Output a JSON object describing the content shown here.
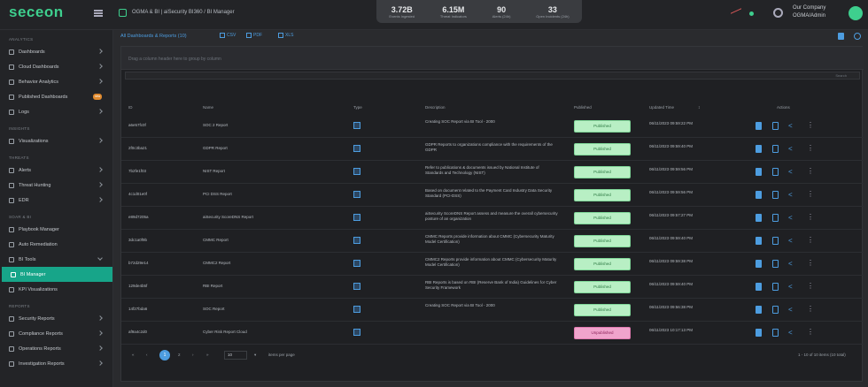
{
  "header": {
    "logo": "seceon",
    "logo_sub": "",
    "breadcrumb": "OGMA & BI | aiSecurity BI360 / BI Manager",
    "stats": [
      {
        "value": "3.72B",
        "label": "Events Ingested"
      },
      {
        "value": "6.15M",
        "label": "Threat Indicators"
      },
      {
        "value": "90",
        "label": "Alerts (24h)"
      },
      {
        "value": "33",
        "label": "Open Incidents (24h)"
      }
    ],
    "company": "Our Company",
    "user": "OGMA/Admin"
  },
  "sidebar": {
    "sections": [
      {
        "title": "ANALYTICS",
        "items": [
          {
            "label": "Dashboards",
            "chev": true
          },
          {
            "label": "Cloud Dashboards",
            "chev": true
          },
          {
            "label": "Behavior Analytics",
            "chev": true
          },
          {
            "label": "Published Dashboards",
            "badge": "new"
          },
          {
            "label": "Logs",
            "chev": true
          }
        ]
      },
      {
        "title": "INSIGHTS",
        "items": [
          {
            "label": "Visualizations",
            "chev": true
          }
        ]
      },
      {
        "title": "THREATS",
        "items": [
          {
            "label": "Alerts",
            "chev": true
          },
          {
            "label": "Threat Hunting",
            "chev": true
          },
          {
            "label": "EDR",
            "chev": true
          }
        ]
      },
      {
        "title": "SOAR & BI",
        "items": [
          {
            "label": "Playbook Manager"
          },
          {
            "label": "Auto Remediation"
          },
          {
            "label": "BI Tools",
            "chev": true,
            "open": true
          },
          {
            "label": "BI Manager",
            "active": true
          },
          {
            "label": "KPI Visualizations"
          }
        ]
      },
      {
        "title": "REPORTS",
        "items": [
          {
            "label": "Security Reports",
            "chev": true
          },
          {
            "label": "Compliance Reports",
            "chev": true
          },
          {
            "label": "Operations Reports",
            "chev": true
          },
          {
            "label": "Investigation Reports",
            "chev": true
          }
        ]
      }
    ]
  },
  "toolbar": {
    "title": "All Dashboards & Reports (10)",
    "buttons": [
      "CSV",
      "PDF",
      "XLS"
    ]
  },
  "grid": {
    "group_hint": "Drag a column header here to group by column",
    "search_placeholder": "Search",
    "columns": {
      "id": "ID",
      "name": "Name",
      "type": "Type",
      "description": "Description",
      "published": "Published",
      "updated": "Updated Time",
      "actions": "Actions"
    },
    "rows": [
      {
        "id": "a6e57fc0f",
        "name": "SOC 2 Report",
        "desc": "Creating SOC Report via BI Tool - 2000",
        "status": "Published",
        "published": true,
        "updated": "06/11/2023 09:59:22 PM"
      },
      {
        "id": "2f0c3ba21",
        "name": "GDPR Report",
        "desc": "GDPR Reports to organizations compliance with the requirements of the GDPR",
        "status": "Published",
        "published": true,
        "updated": "06/11/2023 09:59:40 PM"
      },
      {
        "id": "7b2fe1f03",
        "name": "NIST Report",
        "desc": "Refer to publications & documents issued by National Institute of Standards and Technology (NIST)",
        "status": "Published",
        "published": true,
        "updated": "06/11/2023 09:59:56 PM"
      },
      {
        "id": "4c1d01e0f",
        "name": "PCI DSS Report",
        "desc": "Based on document related to the Payment Card Industry Data Security Standard (PCI-DSS)",
        "status": "Published",
        "published": true,
        "updated": "06/11/2023 09:59:56 PM"
      },
      {
        "id": "e89d7205a",
        "name": "aiSecurity ScoreDNS Report",
        "desc": "aiSecurity ScoreDNS Report assess and measure the overall cybersecurity posture of an organization",
        "status": "Published",
        "published": true,
        "updated": "06/11/2023 09:57:27 PM"
      },
      {
        "id": "3dc1a0f9b",
        "name": "CMMC Report",
        "desc": "CMMC Reports provide information about CMMC (Cybersecurity Maturity Model Certification)",
        "status": "Published",
        "published": true,
        "updated": "06/11/2023 09:59:40 PM"
      },
      {
        "id": "b72d29e14",
        "name": "CMMC2 Report",
        "desc": "CMMC2 Reports provide information about CMMC (Cybersecurity Maturity Model Certification)",
        "status": "Published",
        "published": true,
        "updated": "06/11/2023 09:59:38 PM"
      },
      {
        "id": "129de4b5f",
        "name": "RBI Report",
        "desc": "RBI Reports is based on RBI (Reserve Bank of India) Guidelines for Cyber Security Framework",
        "status": "Published",
        "published": true,
        "updated": "06/11/2023 09:59:40 PM"
      },
      {
        "id": "14f27bda6",
        "name": "SOC Report",
        "desc": "Creating SOC Report via BI Tool - 2000",
        "status": "Published",
        "published": true,
        "updated": "06/11/2023 09:56:38 PM"
      },
      {
        "id": "af9a4c2d0",
        "name": "Cyber Risk Report Cloud",
        "desc": "",
        "status": "Unpublished",
        "published": false,
        "updated": "06/11/2023 10:17:13 PM"
      }
    ]
  },
  "pager": {
    "prev": "‹",
    "first": "«",
    "current": "1",
    "page2": "2",
    "next": "›",
    "last": "»",
    "page_size": "10",
    "per_page_label": "items per page",
    "summary": "1 - 10 of 10 items (10 total)"
  },
  "colors": {
    "accent": "#4d9de0",
    "brand": "#3ecf8e",
    "active": "#17a589",
    "published_bg": "#b8efc4",
    "unpublished_bg": "#f0a4cc"
  }
}
